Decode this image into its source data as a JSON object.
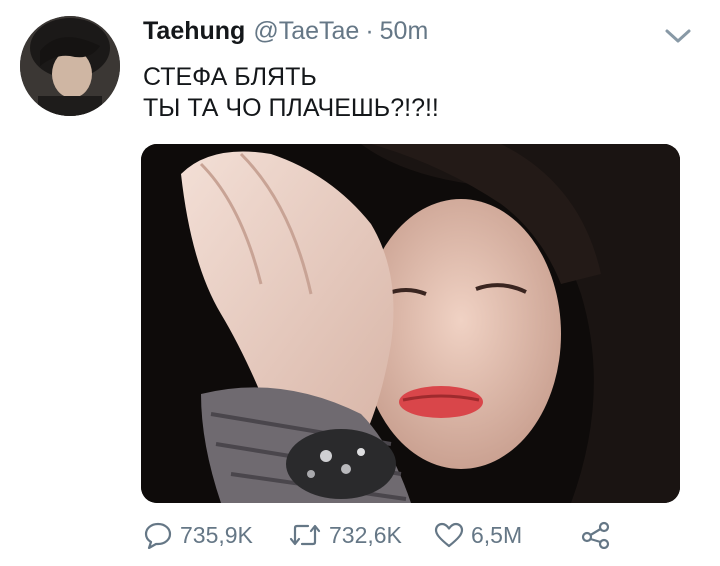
{
  "tweet": {
    "author_name": "Taehung",
    "handle": "@TaeTae",
    "separator": "·",
    "time": "50m",
    "text_lines": [
      "СТЕФА БЛЯТЬ",
      "ТЫ ТА ЧО ПЛАЧЕШЬ?!?!!"
    ]
  },
  "actions": {
    "replies": "735,9K",
    "retweets": "732,6K",
    "likes": "6,5M"
  },
  "icons": {
    "caret": "chevron-down-icon",
    "reply": "reply-bubble-icon",
    "retweet": "retweet-icon",
    "like": "heart-icon",
    "share": "share-icon"
  },
  "colors": {
    "text": "#14171a",
    "muted": "#657786"
  }
}
